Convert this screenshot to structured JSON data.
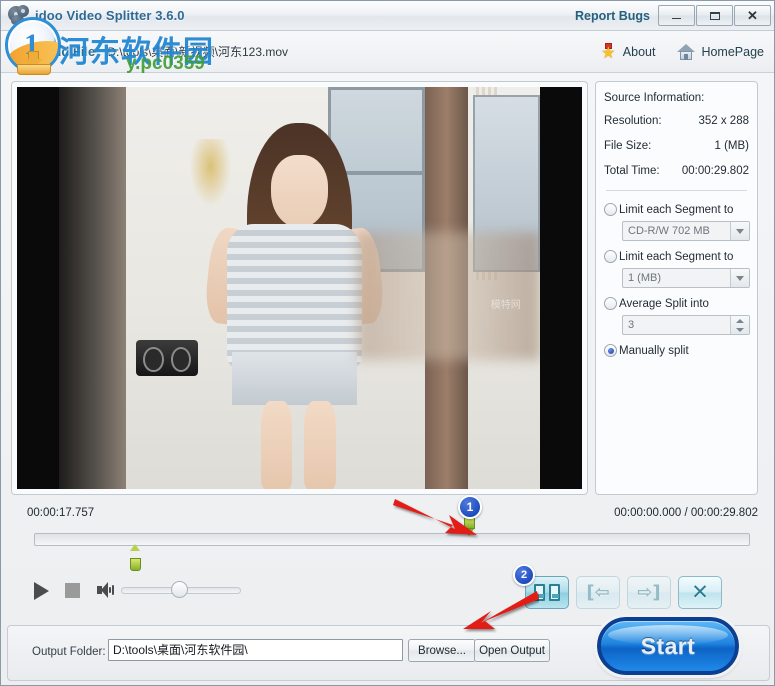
{
  "titlebar": {
    "app_name": "idoo Video Splitter 3.6.0",
    "report_bugs": "Report Bugs",
    "minimize": "–",
    "maximize": "□",
    "close": "✕"
  },
  "watermark": {
    "text_cn": "河东软件园",
    "text_en": "y.pc0359",
    "digit": "1"
  },
  "toolbar": {
    "add_file_label": "Add File",
    "file_path": "D:\\tools\\桌面\\新视频\\河东123.mov",
    "about_label": "About",
    "homepage_label": "HomePage"
  },
  "source_info": {
    "heading": "Source Information:",
    "rows": [
      {
        "label": "Resolution:",
        "value": "352 x 288"
      },
      {
        "label": "File Size:",
        "value": "1 (MB)"
      },
      {
        "label": "Total Time:",
        "value": "00:00:29.802"
      }
    ]
  },
  "split_options": [
    {
      "label": "Limit each Segment to",
      "selected": false,
      "control": "combo",
      "value": "CD-R/W 702 MB"
    },
    {
      "label": "Limit each Segment to",
      "selected": false,
      "control": "combo",
      "value": "1 (MB)"
    },
    {
      "label": "Average Split into",
      "selected": false,
      "control": "spinner",
      "value": "3"
    },
    {
      "label": "Manually split",
      "selected": true,
      "control": "none",
      "value": ""
    }
  ],
  "timeline": {
    "current_marker_time": "00:00:17.757",
    "position_and_duration": "00:00:00.000 / 00:00:29.802",
    "marker_badge_label": "1"
  },
  "player": {
    "play_icon": "play-icon",
    "stop_icon": "stop-icon",
    "volume_icon": "volume-icon"
  },
  "segment_buttons": [
    {
      "name": "split-segment-button",
      "icon": "split-icon",
      "glyph": "",
      "state": "active",
      "badge": "2"
    },
    {
      "name": "previous-segment-button",
      "icon": "prev-segment-icon",
      "glyph": "[⇦",
      "state": "disabled",
      "badge": ""
    },
    {
      "name": "next-segment-button",
      "icon": "next-segment-icon",
      "glyph": "⇨]",
      "state": "disabled",
      "badge": ""
    },
    {
      "name": "delete-segment-button",
      "icon": "close-x-icon",
      "glyph": "✕",
      "state": "enabled",
      "badge": ""
    }
  ],
  "output": {
    "label": "Output Folder:",
    "path": "D:\\tools\\桌面\\河东软件园\\",
    "placeholder": "Output folder path",
    "browse_label": "Browse...",
    "open_output_label": "Open Output"
  },
  "start": {
    "label": "Start"
  },
  "colors": {
    "accent_blue": "#1f84e0",
    "title_blue": "#2f6a96",
    "marker_green": "#87b02a",
    "badge_blue": "#0b3ab0",
    "annotation_red": "#e21b12",
    "button_teal": "#2a7f93"
  },
  "video_preview": {
    "watermark_text": "模特网"
  }
}
